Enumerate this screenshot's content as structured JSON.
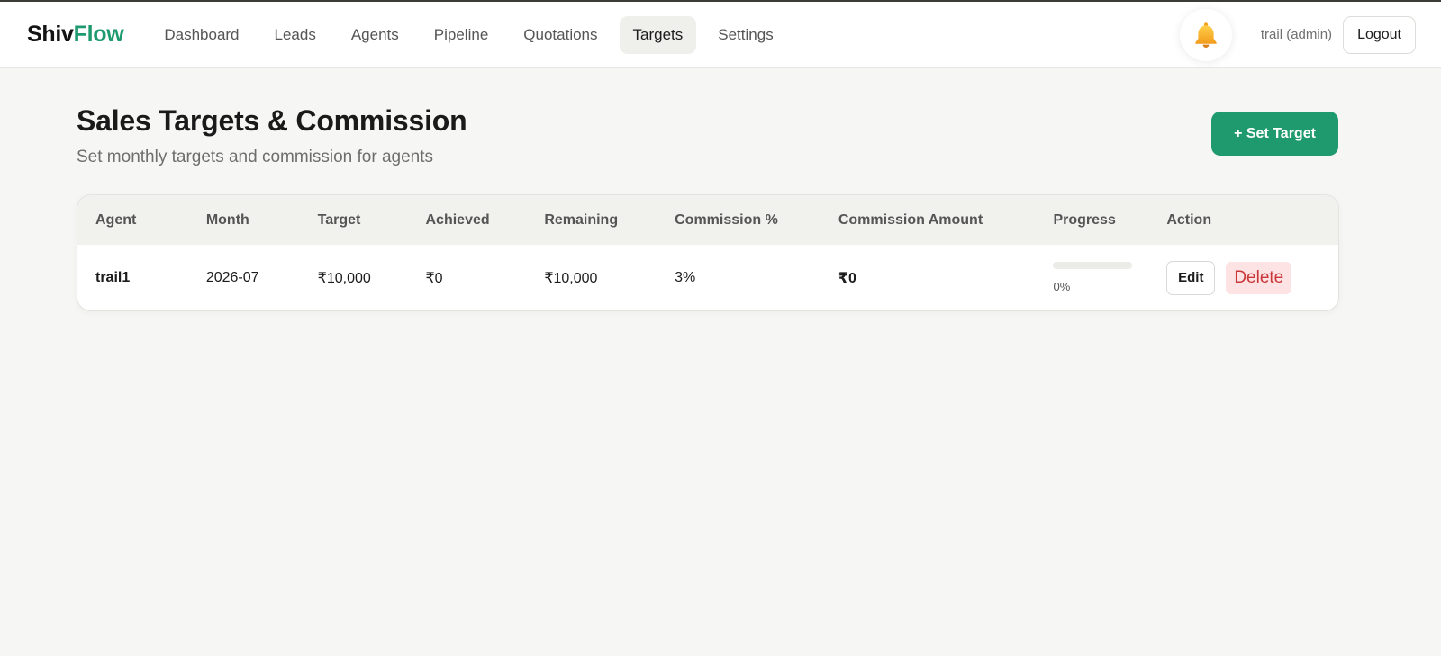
{
  "nav": {
    "brand_part1": "Shiv",
    "brand_part2": "Flow",
    "links": [
      "Dashboard",
      "Leads",
      "Agents",
      "Pipeline",
      "Quotations",
      "Targets",
      "Settings"
    ],
    "active": "Targets",
    "bell_icon": "bell-icon",
    "user": "trail (admin)",
    "logout": "Logout"
  },
  "page": {
    "title": "Sales Targets & Commission",
    "subtitle": "Set monthly targets and commission for agents",
    "set_target_button": "+ Set Target"
  },
  "table": {
    "headers": [
      "Agent",
      "Month",
      "Target",
      "Achieved",
      "Remaining",
      "Commission %",
      "Commission Amount",
      "Progress",
      "Action"
    ],
    "rows": [
      {
        "agent": "trail1",
        "month": "2026-07",
        "target": "₹10,000",
        "achieved": "₹0",
        "remaining": "₹10,000",
        "commission_pct": "3%",
        "commission_amount": "₹0",
        "progress_value": 0,
        "progress_label": "0%",
        "edit": "Edit",
        "delete": "Delete"
      }
    ]
  },
  "colors": {
    "accent": "#1f9a6f",
    "delete_bg": "#fde3e3",
    "delete_text": "#c9373a"
  }
}
